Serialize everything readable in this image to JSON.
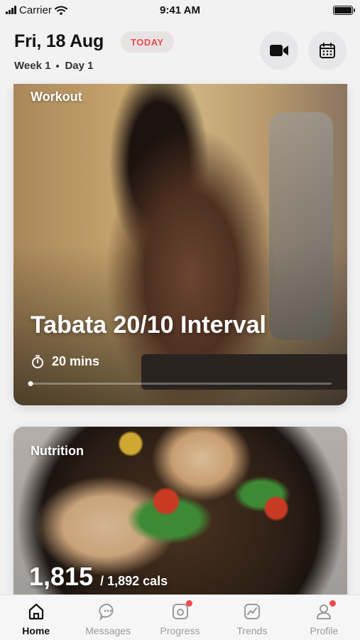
{
  "status_bar": {
    "carrier": "Carrier",
    "time": "9:41 AM"
  },
  "header": {
    "date": "Fri, 18 Aug",
    "today_label": "TODAY",
    "week": "Week 1",
    "day": "Day 1",
    "icons": [
      "video-camera-icon",
      "calendar-icon"
    ]
  },
  "workout_card": {
    "tag": "Workout",
    "title": "Tabata 20/10 Interval",
    "duration": "20 mins",
    "progress": 0.0
  },
  "nutrition_card": {
    "tag": "Nutrition",
    "calories_value": "1,815",
    "calories_total": "/ 1,892 cals"
  },
  "tabs": [
    {
      "label": "Home",
      "icon": "home-icon",
      "active": true,
      "badge": false
    },
    {
      "label": "Messages",
      "icon": "chat-icon",
      "active": false,
      "badge": false
    },
    {
      "label": "Progress",
      "icon": "camera-icon",
      "active": false,
      "badge": true
    },
    {
      "label": "Trends",
      "icon": "trend-chart-icon",
      "active": false,
      "badge": false
    },
    {
      "label": "Profile",
      "icon": "person-icon",
      "active": false,
      "badge": true
    }
  ],
  "colors": {
    "accent": "#e84c50",
    "badge": "#ef4d4d"
  }
}
